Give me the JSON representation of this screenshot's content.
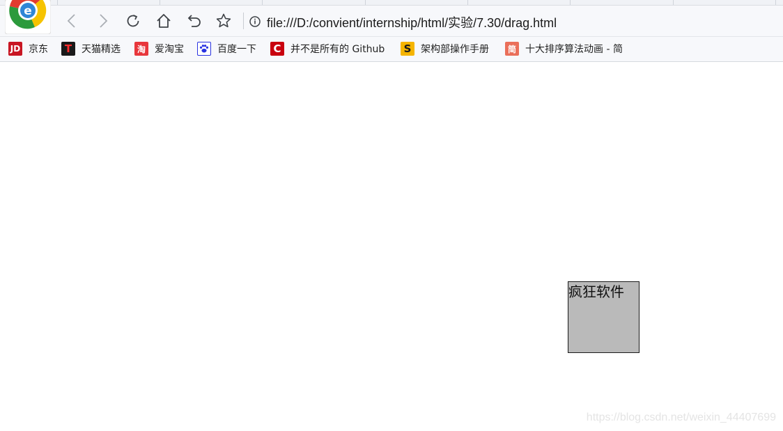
{
  "toolbar": {
    "url": "file:///D:/convient/internship/html/实验/7.30/drag.html"
  },
  "bookmarks": [
    {
      "label": "京东",
      "icon": "jd-icon",
      "icon_text": "JD",
      "color": "#c81623"
    },
    {
      "label": "天猫精选",
      "icon": "tmall-icon",
      "icon_text": "T",
      "color": "#d4001a"
    },
    {
      "label": "爱淘宝",
      "icon": "taobao-icon",
      "icon_text": "淘",
      "color": "#e8373c"
    },
    {
      "label": "百度一下",
      "icon": "baidu-paw-icon",
      "icon_text": "",
      "color": "#2932e1"
    },
    {
      "label": "并不是所有的 Github",
      "icon": "csdn-icon",
      "icon_text": "C",
      "color": "#c9000e"
    },
    {
      "label": "架构部操作手册",
      "icon": "s-logo-icon",
      "icon_text": "S",
      "color": "#f5b400"
    },
    {
      "label": "十大排序算法动画 - 简",
      "icon": "jianshu-icon",
      "icon_text": "简",
      "color": "#ea6f5a"
    }
  ],
  "drag_box": {
    "text": "疯狂软件",
    "background": "#bababa"
  },
  "watermark": "https://blog.csdn.net/weixin_44407699"
}
